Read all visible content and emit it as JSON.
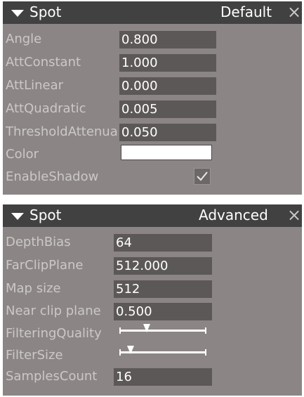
{
  "panel1": {
    "title": "Spot",
    "mode": "Default",
    "close": "×",
    "rows": [
      {
        "label": "Angle",
        "value": "0.800"
      },
      {
        "label": "AttConstant",
        "value": "1.000"
      },
      {
        "label": "AttLinear",
        "value": "0.000"
      },
      {
        "label": "AttQuadratic",
        "value": "0.005"
      },
      {
        "label": "ThresholdAttenuation",
        "value": "0.050"
      },
      {
        "label": "Color",
        "value": "#ffffff"
      },
      {
        "label": "EnableShadow",
        "checked": true
      }
    ]
  },
  "panel2": {
    "title": "Spot",
    "mode": "Advanced",
    "close": "×",
    "rows": [
      {
        "label": "DepthBias",
        "value": "64"
      },
      {
        "label": "FarClipPlane",
        "value": "512.000"
      },
      {
        "label": "Map size",
        "value": "512"
      },
      {
        "label": "Near clip plane",
        "value": "0.500"
      },
      {
        "label": "FilteringQuality",
        "slider_fraction": 0.3
      },
      {
        "label": "FilterSize",
        "slider_fraction": 0.1
      },
      {
        "label": "SamplesCount",
        "value": "16"
      }
    ]
  },
  "icons": {
    "collapse": "triangle-down-icon",
    "close": "close-icon",
    "check": "check-icon"
  }
}
